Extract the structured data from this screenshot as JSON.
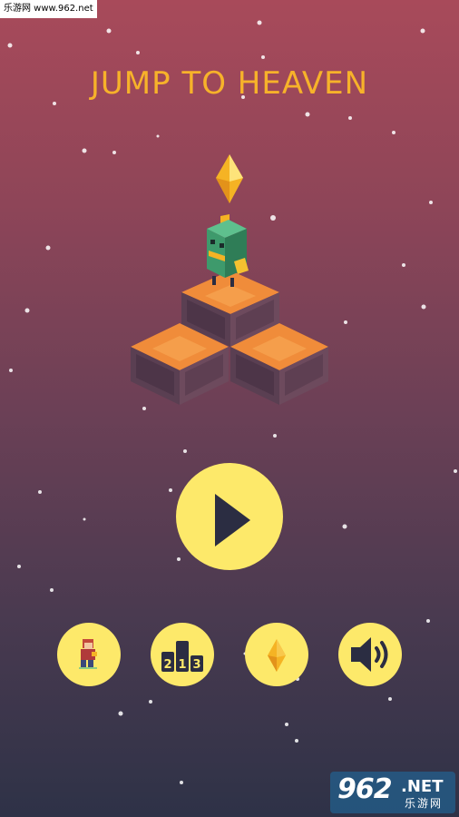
{
  "watermark": {
    "top_text": "乐游网 www.962.net",
    "bottom_number": "962",
    "bottom_suffix": ".NET",
    "bottom_sub": "乐游网"
  },
  "game": {
    "title": "JUMP TO HEAVEN"
  },
  "menu": {
    "play": {
      "icon": "play-icon"
    },
    "buttons": [
      {
        "name": "character-select-button",
        "icon": "character-icon"
      },
      {
        "name": "leaderboard-button",
        "icon": "podium-icon",
        "podium": [
          "2",
          "1",
          "3"
        ]
      },
      {
        "name": "gem-shop-button",
        "icon": "gem-icon"
      },
      {
        "name": "sound-toggle-button",
        "icon": "speaker-icon"
      }
    ]
  },
  "colors": {
    "title": "#f7b22a",
    "button": "#fde96a",
    "icon_dark": "#2b2d42"
  }
}
